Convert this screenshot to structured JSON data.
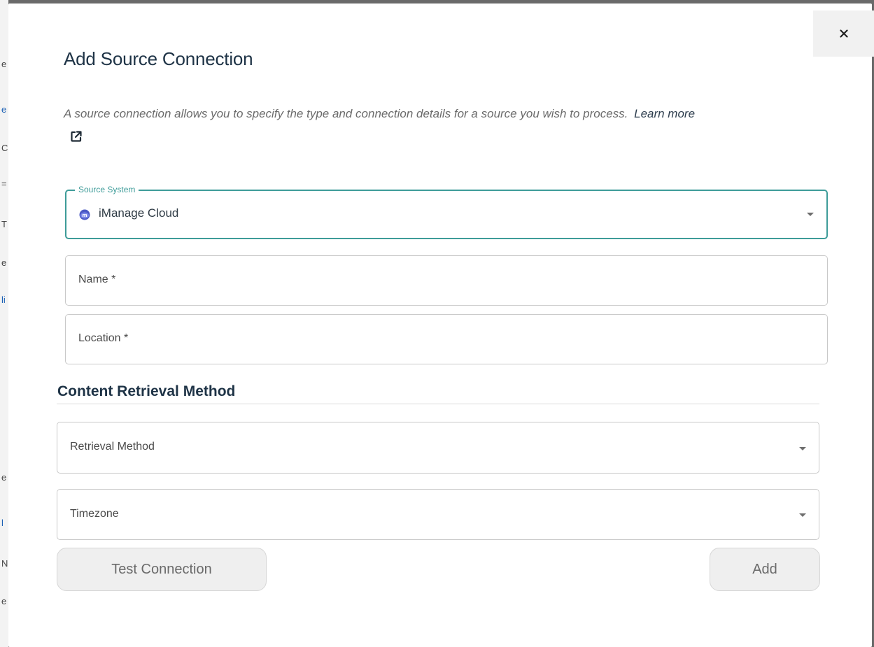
{
  "dialog": {
    "title": "Add Source Connection",
    "close_label": "×",
    "description": "A source connection allows you to specify the type and connection details for a source you wish to process.",
    "learn_more_label": "Learn more",
    "learn_more_icon": "external-link-icon"
  },
  "source_system": {
    "legend": "Source System",
    "value": "iManage Cloud",
    "icon": "imanage-logo-icon"
  },
  "name_field": {
    "placeholder": "Name *"
  },
  "location_field": {
    "placeholder": "Location *"
  },
  "content_retrieval": {
    "section_title": "Content Retrieval Method",
    "retrieval_method_placeholder": "Retrieval Method",
    "timezone_placeholder": "Timezone"
  },
  "actions": {
    "test_connection_label": "Test Connection",
    "add_label": "Add"
  },
  "colors": {
    "accent": "#3e9c99",
    "heading": "#1e3346",
    "button_bg": "#efefef"
  }
}
